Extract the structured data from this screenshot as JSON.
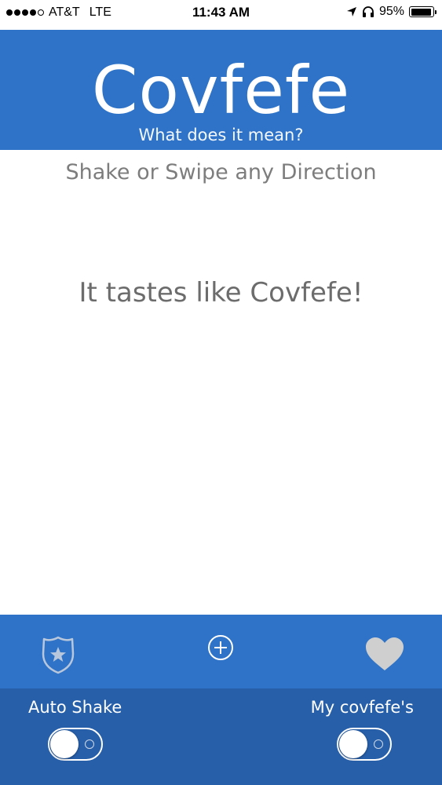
{
  "status_bar": {
    "carrier": "AT&T",
    "network": "LTE",
    "time": "11:43 AM",
    "battery": "95%",
    "battery_level": 0.95,
    "signal_bars_filled": 4,
    "signal_bars_total": 5
  },
  "header": {
    "title": "Covfefe",
    "subtitle": "What does it mean?",
    "background_color": "#2e73c7"
  },
  "main": {
    "instruction": "Shake or Swipe any Direction",
    "message": "It tastes like Covfefe!"
  },
  "toolbar": {
    "left_icon": "police-badge-icon",
    "center_icon": "plus-circle-icon",
    "right_icon": "heart-icon"
  },
  "controls": {
    "auto_shake_label": "Auto Shake",
    "auto_shake_on": false,
    "my_covfefes_label": "My covfefe's",
    "my_covfefes_on": false,
    "background_color": "#275fa9"
  }
}
